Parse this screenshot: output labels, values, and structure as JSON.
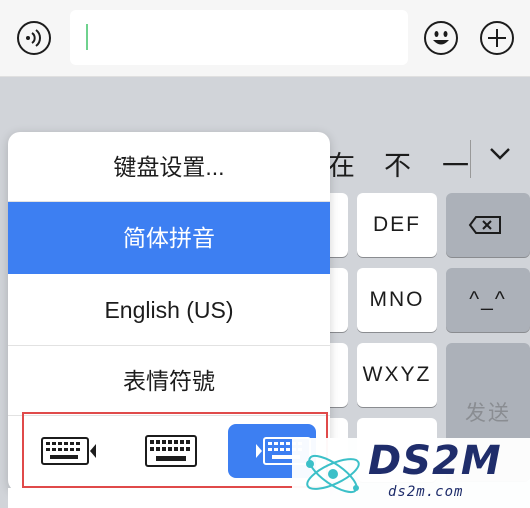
{
  "input": {
    "value": ""
  },
  "candidates": [
    "在",
    "不",
    "一"
  ],
  "keys": {
    "def": "DEF",
    "mno": "MNO",
    "wxyz": "WXYZ",
    "emoticon": "^_^",
    "send": "发送"
  },
  "menu": {
    "items": [
      {
        "label": "键盘设置..."
      },
      {
        "label": "简体拼音",
        "selected": true
      },
      {
        "label": "English (US)"
      },
      {
        "label": "表情符號"
      }
    ]
  },
  "keyboard_layout_options": [
    {
      "icon": "keyboard-left-icon",
      "selected": false
    },
    {
      "icon": "keyboard-full-icon",
      "selected": false
    },
    {
      "icon": "keyboard-right-icon",
      "selected": true
    }
  ],
  "watermark": {
    "logo": "DS2M",
    "url": "ds2m.com"
  },
  "colors": {
    "accent": "#3d7ff2",
    "highlight_border": "#e04a4a",
    "caret": "#6fd28e"
  }
}
